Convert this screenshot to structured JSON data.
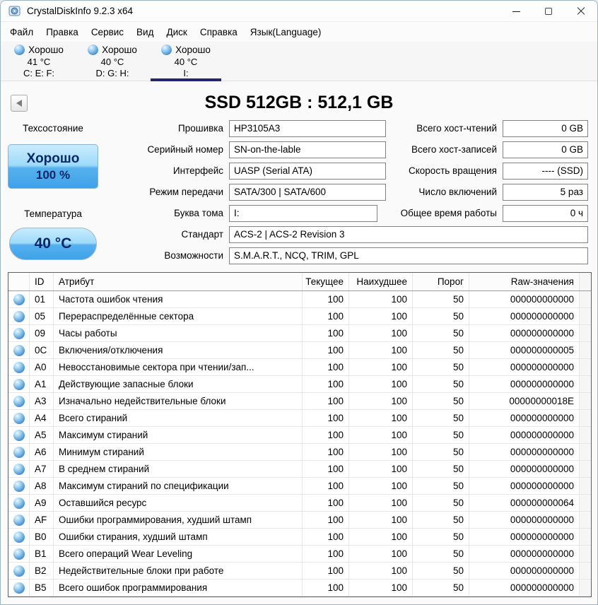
{
  "window": {
    "title": "CrystalDiskInfo 9.2.3 x64"
  },
  "menu": [
    "Файл",
    "Правка",
    "Сервис",
    "Вид",
    "Диск",
    "Справка",
    "Язык(Language)"
  ],
  "drive_tabs": [
    {
      "status": "Хорошо",
      "temp": "41 °C",
      "letters": "C: E: F:",
      "selected": false
    },
    {
      "status": "Хорошо",
      "temp": "40 °C",
      "letters": "D: G: H:",
      "selected": false
    },
    {
      "status": "Хорошо",
      "temp": "40 °C",
      "letters": "I:",
      "selected": true
    }
  ],
  "drive": {
    "title": "SSD 512GB : 512,1 GB",
    "health": {
      "label": "Техсостояние",
      "status": "Хорошо",
      "percent": "100 %"
    },
    "temperature": {
      "label": "Температура",
      "value": "40 °C"
    },
    "fields_left": [
      {
        "label": "Прошивка",
        "value": "HP3105A3"
      },
      {
        "label": "Серийный номер",
        "value": "SN-on-the-lable"
      },
      {
        "label": "Интерфейс",
        "value": "UASP (Serial ATA)"
      },
      {
        "label": "Режим передачи",
        "value": "SATA/300 | SATA/600"
      },
      {
        "label": "Буква тома",
        "value": "I:"
      },
      {
        "label": "Стандарт",
        "value": "ACS-2 | ACS-2 Revision 3"
      },
      {
        "label": "Возможности",
        "value": "S.M.A.R.T., NCQ, TRIM, GPL"
      }
    ],
    "fields_right": [
      {
        "label": "Всего хост-чтений",
        "value": "0 GB"
      },
      {
        "label": "Всего хост-записей",
        "value": "0 GB"
      },
      {
        "label": "Скорость вращения",
        "value": "---- (SSD)"
      },
      {
        "label": "Число включений",
        "value": "5 раз"
      },
      {
        "label": "Общее время работы",
        "value": "0 ч"
      }
    ]
  },
  "smart_table": {
    "headers": [
      "ID",
      "Атрибут",
      "Текущее",
      "Наихудшее",
      "Порог",
      "Raw-значения"
    ],
    "rows": [
      [
        "01",
        "Частота ошибок чтения",
        "100",
        "100",
        "50",
        "000000000000"
      ],
      [
        "05",
        "Перераспределённые сектора",
        "100",
        "100",
        "50",
        "000000000000"
      ],
      [
        "09",
        "Часы работы",
        "100",
        "100",
        "50",
        "000000000000"
      ],
      [
        "0C",
        "Включения/отключения",
        "100",
        "100",
        "50",
        "000000000005"
      ],
      [
        "A0",
        "Невосстановимые сектора при чтении/зап...",
        "100",
        "100",
        "50",
        "000000000000"
      ],
      [
        "A1",
        "Действующие запасные блоки",
        "100",
        "100",
        "50",
        "000000000000"
      ],
      [
        "A3",
        "Изначально недействительные блоки",
        "100",
        "100",
        "50",
        "00000000018E"
      ],
      [
        "A4",
        "Всего стираний",
        "100",
        "100",
        "50",
        "000000000000"
      ],
      [
        "A5",
        "Максимум стираний",
        "100",
        "100",
        "50",
        "000000000000"
      ],
      [
        "A6",
        "Минимум стираний",
        "100",
        "100",
        "50",
        "000000000000"
      ],
      [
        "A7",
        "В среднем стираний",
        "100",
        "100",
        "50",
        "000000000000"
      ],
      [
        "A8",
        "Максимум стираний по спецификации",
        "100",
        "100",
        "50",
        "000000000000"
      ],
      [
        "A9",
        "Оставшийся ресурс",
        "100",
        "100",
        "50",
        "000000000064"
      ],
      [
        "AF",
        "Ошибки программирования, худший штамп",
        "100",
        "100",
        "50",
        "000000000000"
      ],
      [
        "B0",
        "Ошибки стирания, худший штамп",
        "100",
        "100",
        "50",
        "000000000000"
      ],
      [
        "B1",
        "Всего операций Wear Leveling",
        "100",
        "100",
        "50",
        "000000000000"
      ],
      [
        "B2",
        "Недействительные блоки при работе",
        "100",
        "100",
        "50",
        "000000000000"
      ],
      [
        "B5",
        "Всего ошибок программирования",
        "100",
        "100",
        "50",
        "000000000000"
      ]
    ]
  }
}
